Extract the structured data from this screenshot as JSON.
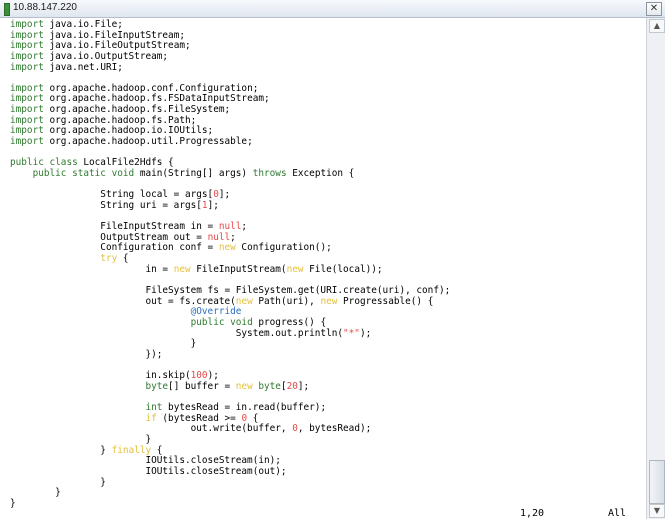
{
  "window": {
    "title": "10.88.147.220",
    "close_glyph": "✕"
  },
  "editor": {
    "lines": [
      {
        "parts": [
          [
            "kw",
            "import"
          ],
          [
            "",
            "java.io.File;"
          ]
        ]
      },
      {
        "parts": [
          [
            "kw",
            "import"
          ],
          [
            "",
            "java.io.FileInputStream;"
          ]
        ]
      },
      {
        "parts": [
          [
            "kw",
            "import"
          ],
          [
            "",
            "java.io.FileOutputStream;"
          ]
        ]
      },
      {
        "parts": [
          [
            "kw",
            "import"
          ],
          [
            "",
            "java.io.OutputStream;"
          ]
        ]
      },
      {
        "parts": [
          [
            "kw",
            "import"
          ],
          [
            "",
            "java.net.URI;"
          ]
        ]
      },
      {
        "parts": []
      },
      {
        "parts": [
          [
            "kw",
            "import"
          ],
          [
            "",
            "org.apache.hadoop.conf.Configuration;"
          ]
        ]
      },
      {
        "parts": [
          [
            "kw",
            "import"
          ],
          [
            "",
            "org.apache.hadoop.fs.FSDataInputStream;"
          ]
        ]
      },
      {
        "parts": [
          [
            "kw",
            "import"
          ],
          [
            "",
            "org.apache.hadoop.fs.FileSystem;"
          ]
        ]
      },
      {
        "parts": [
          [
            "kw",
            "import"
          ],
          [
            "",
            "org.apache.hadoop.fs.Path;"
          ]
        ]
      },
      {
        "parts": [
          [
            "kw",
            "import"
          ],
          [
            "",
            "org.apache.hadoop.io.IOUtils;"
          ]
        ]
      },
      {
        "parts": [
          [
            "kw",
            "import"
          ],
          [
            "",
            "org.apache.hadoop.util.Progressable;"
          ]
        ]
      },
      {
        "parts": []
      },
      {
        "parts": [
          [
            "kw",
            "public class"
          ],
          [
            "",
            "LocalFile2Hdfs {"
          ]
        ]
      },
      {
        "parts": [
          [
            "",
            "    "
          ],
          [
            "kw",
            "public static void"
          ],
          [
            "",
            " main(String[] args) "
          ],
          [
            "kw",
            "throws"
          ],
          [
            "",
            " Exception {"
          ]
        ]
      },
      {
        "parts": []
      },
      {
        "parts": [
          [
            "",
            "                String local = args["
          ],
          [
            "num",
            "0"
          ],
          [
            "",
            "];"
          ]
        ]
      },
      {
        "parts": [
          [
            "",
            "                String uri = args["
          ],
          [
            "num",
            "1"
          ],
          [
            "",
            "];"
          ]
        ]
      },
      {
        "parts": []
      },
      {
        "parts": [
          [
            "",
            "                FileInputStream in = "
          ],
          [
            "num",
            "null"
          ],
          [
            "",
            ";"
          ]
        ]
      },
      {
        "parts": [
          [
            "",
            "                OutputStream out = "
          ],
          [
            "num",
            "null"
          ],
          [
            "",
            ";"
          ]
        ]
      },
      {
        "parts": [
          [
            "",
            "                Configuration conf = "
          ],
          [
            "fade",
            "new"
          ],
          [
            "",
            " Configuration();"
          ]
        ]
      },
      {
        "parts": [
          [
            "",
            "                "
          ],
          [
            "fade",
            "try"
          ],
          [
            "",
            " {"
          ]
        ]
      },
      {
        "parts": [
          [
            "",
            "                        in = "
          ],
          [
            "fade",
            "new"
          ],
          [
            "",
            " FileInputStream("
          ],
          [
            "fade",
            "new"
          ],
          [
            "",
            " File(local));"
          ]
        ]
      },
      {
        "parts": []
      },
      {
        "parts": [
          [
            "",
            "                        FileSystem fs = FileSystem.get(URI.create(uri), conf);"
          ]
        ]
      },
      {
        "parts": [
          [
            "",
            "                        out = fs.create("
          ],
          [
            "fade",
            "new"
          ],
          [
            "",
            " Path(uri), "
          ],
          [
            "fade",
            "new"
          ],
          [
            "",
            " Progressable() {"
          ]
        ]
      },
      {
        "parts": [
          [
            "",
            "                                "
          ],
          [
            "ann",
            "@Override"
          ]
        ]
      },
      {
        "parts": [
          [
            "",
            "                                "
          ],
          [
            "kw",
            "public void"
          ],
          [
            "",
            " progress() {"
          ]
        ]
      },
      {
        "parts": [
          [
            "",
            "                                        System.out.println("
          ],
          [
            "str",
            "\"*\""
          ],
          [
            "",
            ");"
          ]
        ]
      },
      {
        "parts": [
          [
            "",
            "                                }"
          ]
        ]
      },
      {
        "parts": [
          [
            "",
            "                        });"
          ]
        ]
      },
      {
        "parts": []
      },
      {
        "parts": [
          [
            "",
            "                        in.skip("
          ],
          [
            "num",
            "100"
          ],
          [
            "",
            ");"
          ]
        ]
      },
      {
        "parts": [
          [
            "",
            "                        "
          ],
          [
            "kw",
            "byte"
          ],
          [
            "",
            "[] buffer = "
          ],
          [
            "fade",
            "new"
          ],
          [
            "",
            " "
          ],
          [
            "kw",
            "byte"
          ],
          [
            "",
            "["
          ],
          [
            "num",
            "20"
          ],
          [
            "",
            "];"
          ]
        ]
      },
      {
        "parts": []
      },
      {
        "parts": [
          [
            "",
            "                        "
          ],
          [
            "kw",
            "int"
          ],
          [
            "",
            " bytesRead = in.read(buffer);"
          ]
        ]
      },
      {
        "parts": [
          [
            "",
            "                        "
          ],
          [
            "fade",
            "if"
          ],
          [
            "",
            " (bytesRead >= "
          ],
          [
            "num",
            "0"
          ],
          [
            "",
            " {"
          ]
        ]
      },
      {
        "parts": [
          [
            "",
            "                                out.write(buffer, "
          ],
          [
            "num",
            "0"
          ],
          [
            "",
            ", bytesRead);"
          ]
        ]
      },
      {
        "parts": [
          [
            "",
            "                        }"
          ]
        ]
      },
      {
        "parts": [
          [
            "",
            "                } "
          ],
          [
            "fade",
            "finally"
          ],
          [
            "",
            " {"
          ]
        ]
      },
      {
        "parts": [
          [
            "",
            "                        IOUtils.closeStream(in);"
          ]
        ]
      },
      {
        "parts": [
          [
            "",
            "                        IOUtils.closeStream(out);"
          ]
        ]
      },
      {
        "parts": [
          [
            "",
            "                }"
          ]
        ]
      },
      {
        "parts": [
          [
            "",
            "        }"
          ]
        ]
      },
      {
        "parts": [
          [
            "",
            "}"
          ]
        ]
      }
    ]
  },
  "scrollbar": {
    "up_glyph": "▲",
    "down_glyph": "▼"
  },
  "status": {
    "position": "1,20",
    "scroll": "All"
  }
}
